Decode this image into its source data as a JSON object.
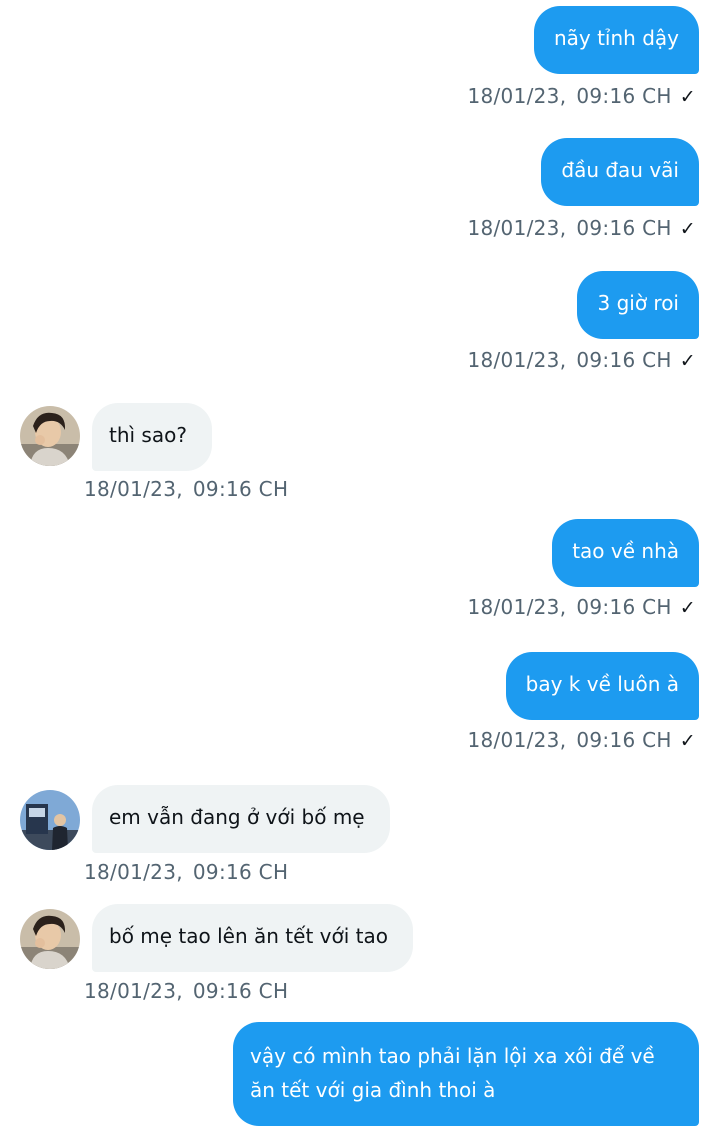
{
  "messages": [
    {
      "direction": "out",
      "text": "nãy tỉnh dậy",
      "date": "18/01/23,",
      "time": "09:16 CH",
      "status": "sent-check-icon"
    },
    {
      "direction": "out",
      "text": "đầu đau vãi",
      "date": "18/01/23,",
      "time": "09:16 CH",
      "status": "sent-check-icon"
    },
    {
      "direction": "out",
      "text": "3 giờ roi",
      "date": "18/01/23,",
      "time": "09:16 CH",
      "status": "sent-check-icon"
    },
    {
      "direction": "in",
      "text": "thì sao?",
      "date": "18/01/23,",
      "time": "09:16 CH",
      "avatar": "portrait-avatar"
    },
    {
      "direction": "out",
      "text": "tao về nhà",
      "date": "18/01/23,",
      "time": "09:16 CH",
      "status": "sent-check-icon"
    },
    {
      "direction": "out",
      "text": "bay k về luôn à",
      "date": "18/01/23,",
      "time": "09:16 CH",
      "status": "sent-check-icon"
    },
    {
      "direction": "in",
      "text": "em vẫn đang ở với bố mẹ",
      "date": "18/01/23,",
      "time": "09:16 CH",
      "avatar": "outdoor-avatar"
    },
    {
      "direction": "in",
      "text": "bố mẹ tao lên ăn tết với tao",
      "date": "18/01/23,",
      "time": "09:16 CH",
      "avatar": "portrait-avatar"
    },
    {
      "direction": "out",
      "text": "vậy có mình tao phải lặn lội xa xôi để về ăn tết với gia đình thoi à"
    }
  ],
  "theme": {
    "outgoing_bubble": "#1d9bf0",
    "incoming_bubble": "#eff3f4",
    "meta_text": "#536471",
    "body_text": "#0f1419",
    "background": "#ffffff"
  },
  "icons": {
    "check": "✓"
  }
}
